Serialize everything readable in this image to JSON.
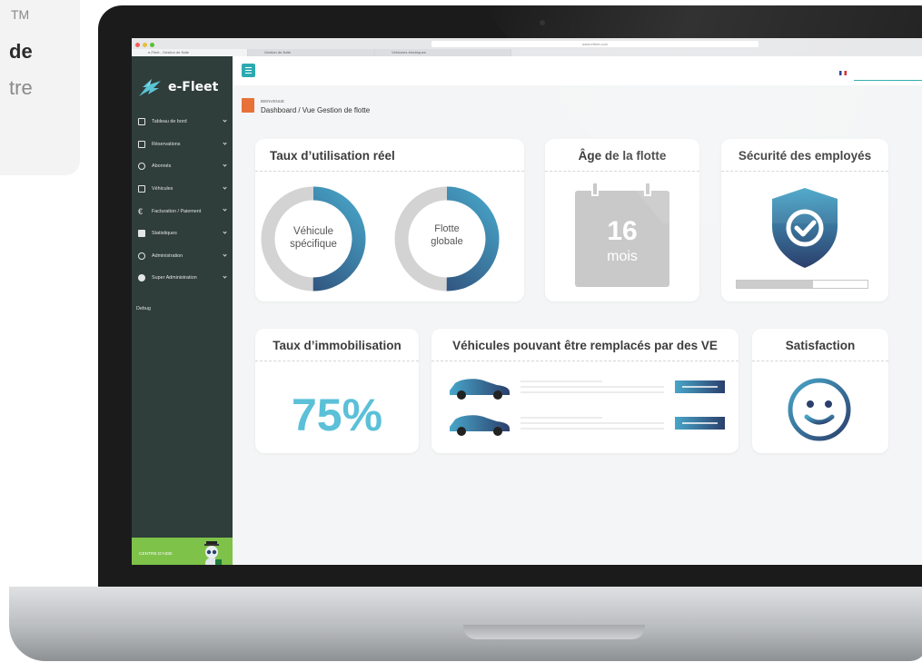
{
  "left_fragment": {
    "line1": "TM",
    "line2": "de",
    "line3": "tre"
  },
  "browser": {
    "url": "www.efleet.com",
    "tabs": [
      "e-Fleet - Gestion de flotte",
      "Gestion de flotte",
      "Véhicules électriques"
    ]
  },
  "sidebar": {
    "logo": "e-Fleet",
    "items": [
      {
        "label": "Tableau de bord",
        "icon": "dashboard-icon"
      },
      {
        "label": "Réservations",
        "icon": "calendar-icon"
      },
      {
        "label": "Abonnés",
        "icon": "users-icon"
      },
      {
        "label": "Véhicules",
        "icon": "car-icon"
      },
      {
        "label": "Facturation / Paiement",
        "icon": "euro-icon"
      },
      {
        "label": "Statistiques",
        "icon": "stats-icon"
      },
      {
        "label": "Administration",
        "icon": "settings-icon"
      },
      {
        "label": "Super Administration",
        "icon": "gear-icon"
      }
    ],
    "debug": "Debug",
    "help": "CENTRE D'AIDE"
  },
  "header": {
    "language": "FR",
    "flag_colors": [
      "#1c3c8c",
      "#ffffff",
      "#dd2222"
    ]
  },
  "breadcrumb": {
    "welcome": "BIENVENUE",
    "path": "Dashboard / Vue Gestion de flotte"
  },
  "cards": {
    "utilisation": {
      "title": "Taux d’utilisation réel",
      "donut1": {
        "line1": "Véhicule",
        "line2": "spécifique",
        "fraction": 0.5
      },
      "donut2": {
        "line1": "Flotte",
        "line2": "globale",
        "fraction": 0.5
      }
    },
    "age": {
      "title": "Âge de la flotte",
      "value": "16",
      "unit": "mois"
    },
    "securite": {
      "title": "Sécurité des employés",
      "progress": 0.58
    },
    "immobilisation": {
      "title": "Taux d’immobilisation",
      "value": "75%"
    },
    "remplacement": {
      "title": "Véhicules pouvant être remplacés par des VE"
    },
    "satisfaction": {
      "title": "Satisfaction"
    }
  },
  "colors": {
    "teal": "#2daab0",
    "navy": "#2b3f6c",
    "cyan": "#5bc0d8",
    "green": "#7ec24a",
    "sidebar": "#2f3d3b",
    "orange": "#e8713a"
  }
}
